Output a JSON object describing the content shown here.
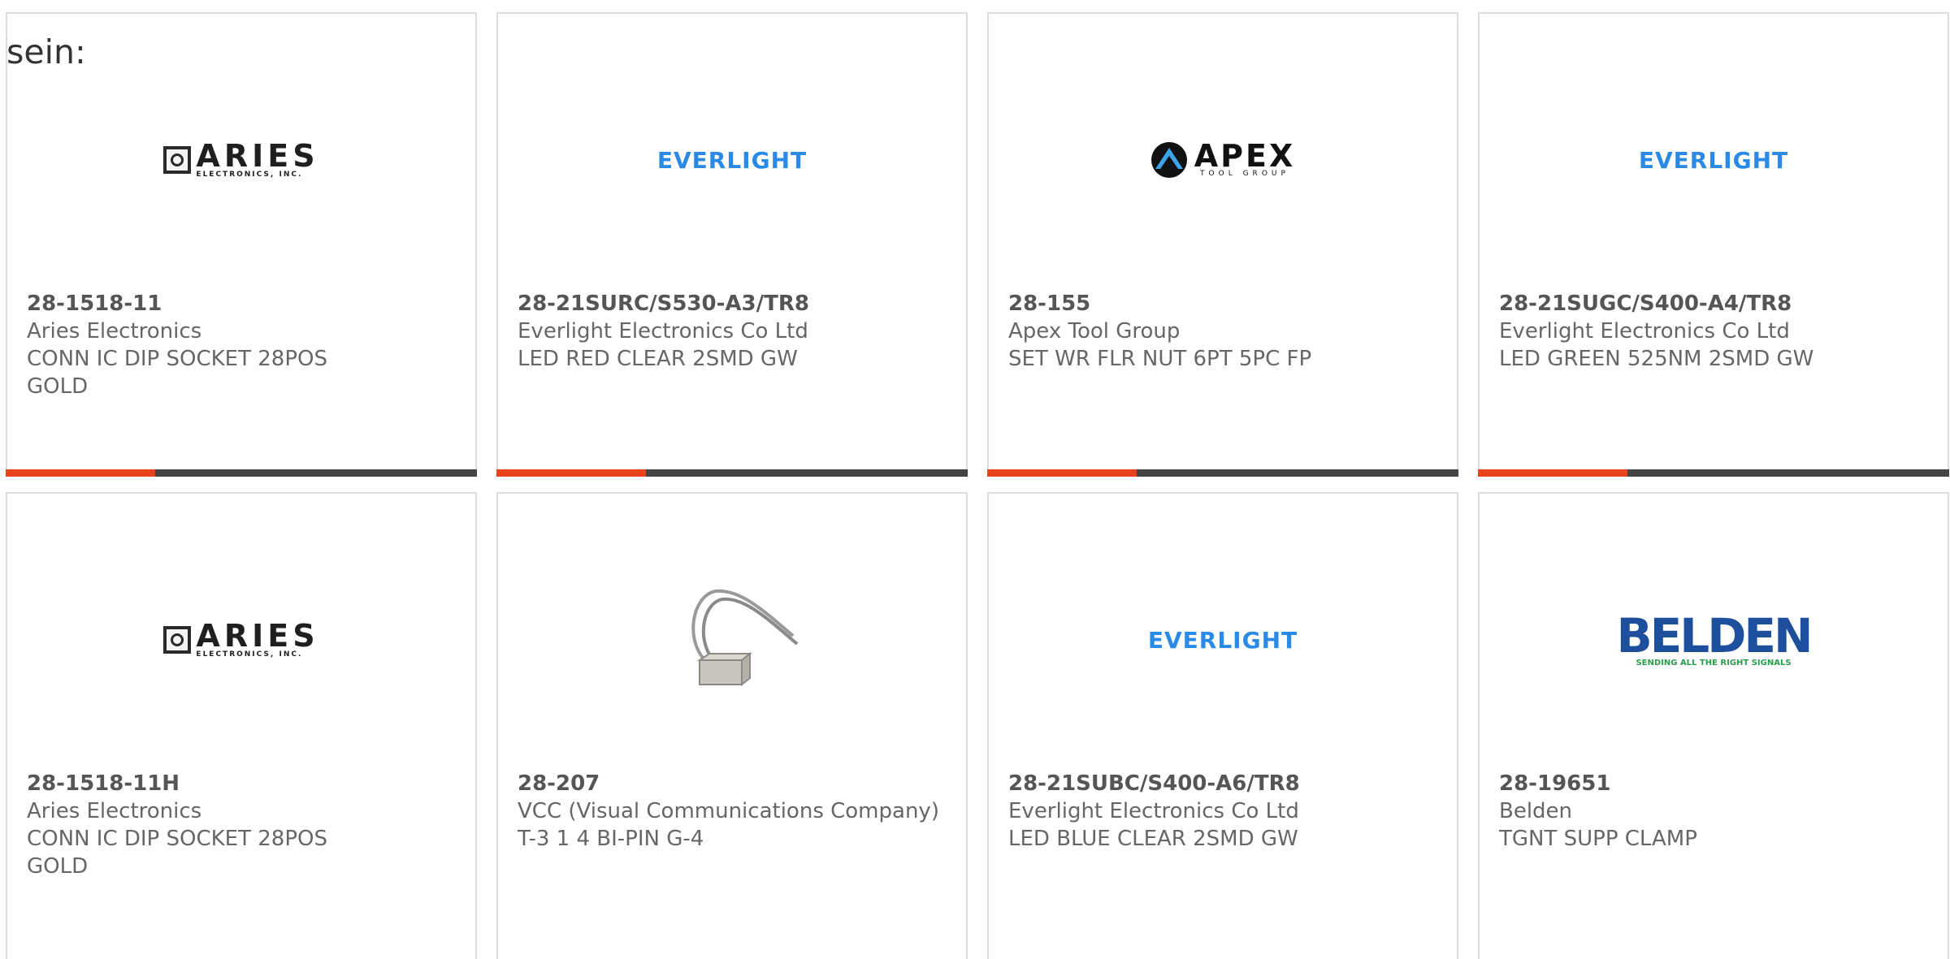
{
  "header": {
    "text": "sein:"
  },
  "products": [
    {
      "part_number": "28-1518-11",
      "manufacturer": "Aries Electronics",
      "description_line1": "CONN IC DIP SOCKET 28POS",
      "description_line2": "GOLD",
      "logo": {
        "name": "aries-logo",
        "text": "ARIES",
        "subtext": "ELECTRONICS, INC."
      }
    },
    {
      "part_number": "28-21SURC/S530-A3/TR8",
      "manufacturer": "Everlight Electronics Co Ltd",
      "description_line1": "LED RED CLEAR 2SMD GW",
      "description_line2": "",
      "logo": {
        "name": "everlight-logo",
        "text": "EVERLIGHT"
      }
    },
    {
      "part_number": "28-155",
      "manufacturer": "Apex Tool Group",
      "description_line1": "SET WR FLR NUT 6PT 5PC FP",
      "description_line2": "",
      "logo": {
        "name": "apex-logo",
        "text": "APEX",
        "subtext": "TOOL GROUP"
      }
    },
    {
      "part_number": "28-21SUGC/S400-A4/TR8",
      "manufacturer": "Everlight Electronics Co Ltd",
      "description_line1": "LED GREEN 525NM 2SMD GW",
      "description_line2": "",
      "logo": {
        "name": "everlight-logo",
        "text": "EVERLIGHT"
      }
    },
    {
      "part_number": "28-1518-11H",
      "manufacturer": "Aries Electronics",
      "description_line1": "CONN IC DIP SOCKET 28POS",
      "description_line2": "GOLD",
      "logo": {
        "name": "aries-logo",
        "text": "ARIES",
        "subtext": "ELECTRONICS, INC."
      }
    },
    {
      "part_number": "28-207",
      "manufacturer": "VCC (Visual Communications Company)",
      "description_line1": "T-3 1 4 BI-PIN G-4",
      "description_line2": "",
      "logo": {
        "name": "product-photo",
        "text": ""
      }
    },
    {
      "part_number": "28-21SUBC/S400-A6/TR8",
      "manufacturer": "Everlight Electronics Co Ltd",
      "description_line1": "LED BLUE CLEAR 2SMD GW",
      "description_line2": "",
      "logo": {
        "name": "everlight-logo",
        "text": "EVERLIGHT"
      }
    },
    {
      "part_number": "28-19651",
      "manufacturer": "Belden",
      "description_line1": "TGNT SUPP CLAMP",
      "description_line2": "",
      "logo": {
        "name": "belden-logo",
        "text": "BELDEN",
        "subtext": "SENDING ALL THE RIGHT SIGNALS"
      }
    }
  ],
  "colors": {
    "accent": "#e8431c",
    "bar": "#444444",
    "everlight_blue": "#2b8ae6",
    "belden_blue": "#1d4f9c",
    "belden_green": "#2a9d4a"
  }
}
